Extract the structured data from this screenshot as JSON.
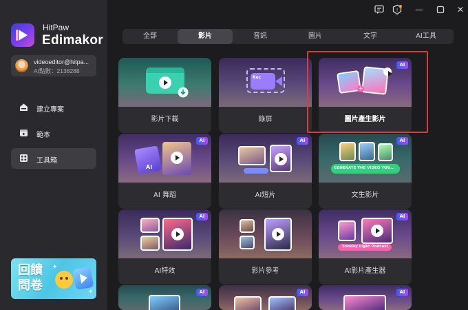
{
  "sidebar": {
    "brand_top": "HitPaw",
    "brand_name": "Edimakor",
    "user_email": "videoeditor@hitpa...",
    "user_points": "AI點數：2138288",
    "nav": [
      {
        "label": "建立專案",
        "icon": "new-project-icon",
        "active": false
      },
      {
        "label": "範本",
        "icon": "template-icon",
        "active": false
      },
      {
        "label": "工具箱",
        "icon": "toolbox-icon",
        "active": true
      }
    ],
    "survey_text": "回饋問卷"
  },
  "tabs": [
    {
      "label": "全部",
      "active": false
    },
    {
      "label": "影片",
      "active": true
    },
    {
      "label": "音訊",
      "active": false
    },
    {
      "label": "圖片",
      "active": false
    },
    {
      "label": "文字",
      "active": false
    },
    {
      "label": "AI工具",
      "active": false
    }
  ],
  "cards": [
    {
      "label": "影片下載",
      "ai": false
    },
    {
      "label": "錄屏",
      "ai": false,
      "rec_text": "Rec"
    },
    {
      "label": "圖片產生影片",
      "ai": true,
      "selected": true
    },
    {
      "label": "AI 舞蹈",
      "ai": true
    },
    {
      "label": "AI短片",
      "ai": true
    },
    {
      "label": "文生影片",
      "ai": true,
      "prompt_text": "GENERATE THE VIDEO YOU..."
    },
    {
      "label": "AI特效",
      "ai": true
    },
    {
      "label": "影片參考",
      "ai": false
    },
    {
      "label": "AI影片產生器",
      "ai": true,
      "podcast_text": "Sunday Light Podcast"
    }
  ],
  "ai_badge_text": "AI",
  "colors": {
    "accent_highlight": "#e03b3b",
    "sidebar_bg": "#2a2a2e",
    "app_bg": "#1c1c1f",
    "ai_badge": "#6a4bff"
  }
}
